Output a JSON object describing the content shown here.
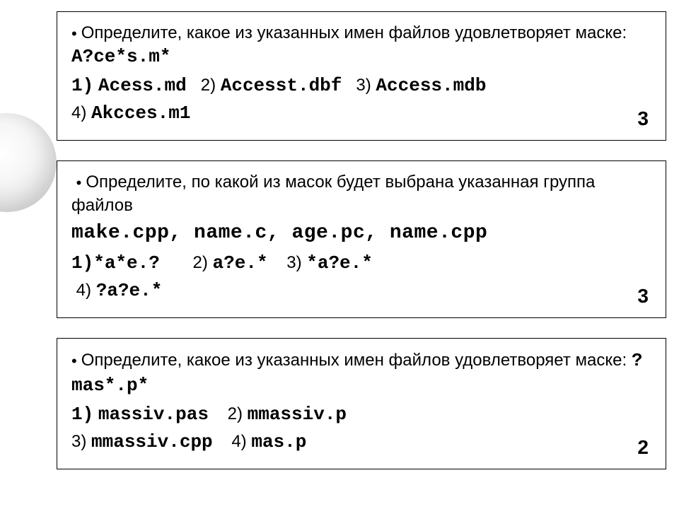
{
  "bullet": "•",
  "box1": {
    "prompt_a": "Определите, какое из указанных имен файлов удовлетворяет маске: ",
    "mask": "A?ce*s.m*",
    "n1": "1)",
    "f1": "Acess.md",
    "n2": "2)",
    "f2": "Accesst.dbf",
    "n3": "3)",
    "f3": "Access.mdb",
    "n4": "4)",
    "f4": "Akcces.m1",
    "answer": "3"
  },
  "box2": {
    "prompt_a": "Определите, по какой из масок будет выбрана указанная группа файлов",
    "files": " make.cpp, name.c, age.pc, name.cpp",
    "n1": "1)",
    "o1": "*a*e.?",
    "n2": "2)",
    "o2": "a?e.*",
    "n3": "3)",
    "o3": "*a?e.*",
    "n4": "4)",
    "o4": "?a?e.*",
    "answer": "3"
  },
  "box3": {
    "prompt_a": "Определите, какое из указанных имен файлов удовлетворяет маске: ",
    "mask": "?mas*.p*",
    "n1": "1)",
    "f1": "massiv.pas",
    "n2": "2)",
    "f2": "mmassiv.p",
    "n3": "3)",
    "f3": "mmassiv.cpp",
    "n4": "4)",
    "f4": "mas.p",
    "answer": "2"
  }
}
